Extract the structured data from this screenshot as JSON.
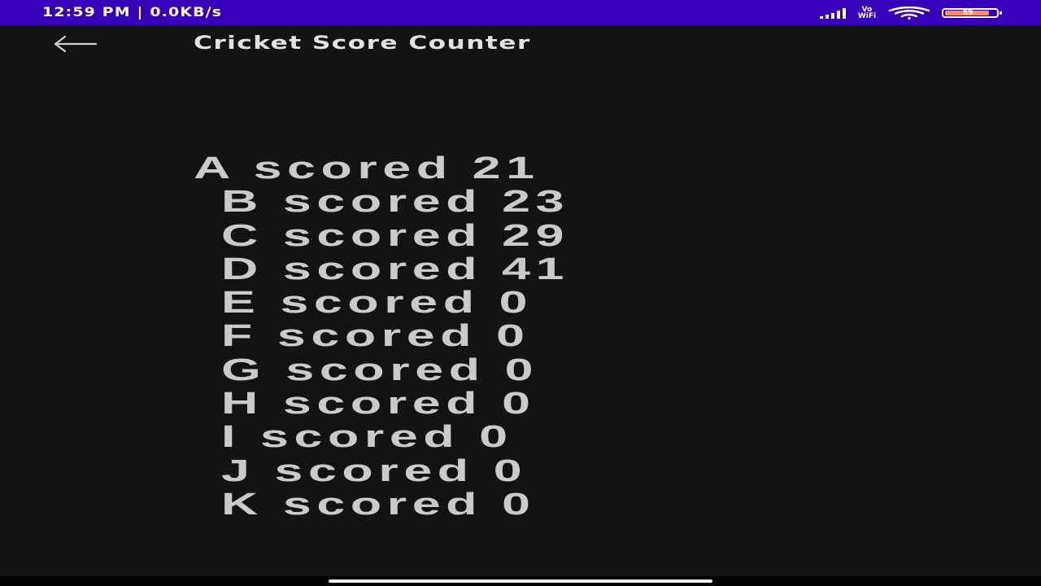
{
  "status_bar": {
    "time_speed": "12:59 PM | 0.0KB/s",
    "vowifi_top": "Vo",
    "vowifi_bottom": "WiFi",
    "battery_level": "89",
    "battery_fraction": 0.89,
    "icons": [
      "signal-icon",
      "vowifi-icon",
      "wifi-icon",
      "battery-icon"
    ],
    "color": "#3500b8"
  },
  "app_bar": {
    "back_icon": "arrow-left-icon",
    "title": "Cricket Score Counter"
  },
  "scores": [
    {
      "text": "A scored 21"
    },
    {
      "text": "B scored 23"
    },
    {
      "text": "C scored 29"
    },
    {
      "text": "D scored 41"
    },
    {
      "text": "E scored 0"
    },
    {
      "text": "F scored 0"
    },
    {
      "text": "G scored 0"
    },
    {
      "text": "H scored 0"
    },
    {
      "text": "I scored 0"
    },
    {
      "text": "J scored 0"
    },
    {
      "text": "K scored 0"
    }
  ],
  "colors": {
    "background": "#131313",
    "text": "#cacaca",
    "title": "#e2e2e2"
  }
}
